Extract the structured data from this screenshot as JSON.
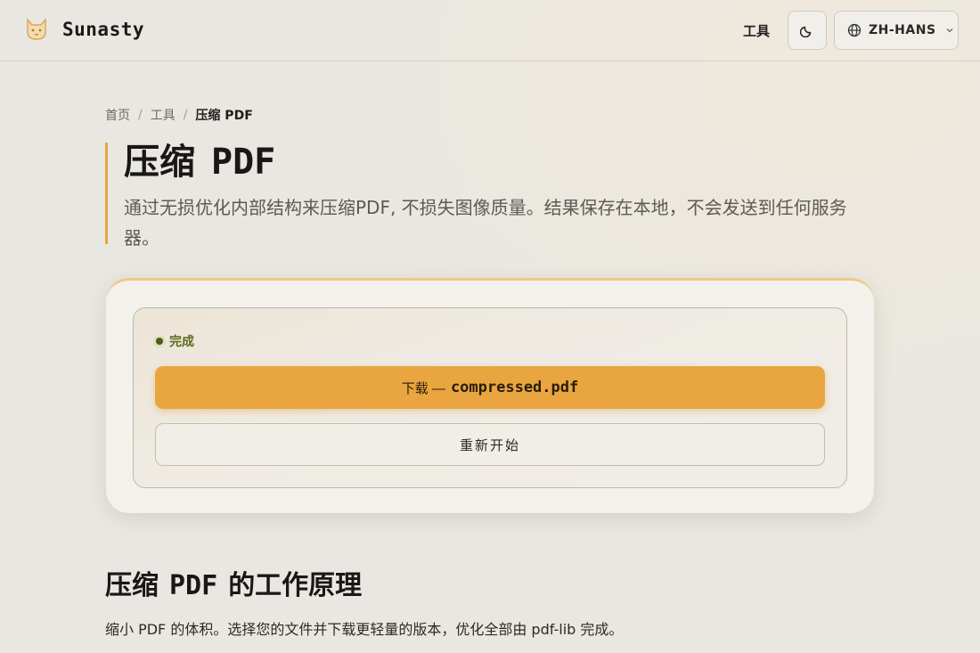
{
  "header": {
    "brand": "Sunasty",
    "nav_tools": "工具",
    "language": "ZH-HANS"
  },
  "breadcrumb": {
    "home": "首页",
    "tools": "工具",
    "current": "压缩 PDF"
  },
  "page": {
    "title_zh": "压缩",
    "title_pdf": "PDF",
    "description": "通过无损优化内部结构来压缩PDF, 不损失图像质量。结果保存在本地，不会发送到任何服务器。"
  },
  "result": {
    "status": "完成",
    "download_label": "下载 —",
    "download_filename": "compressed.pdf",
    "restart_label": "重新开始"
  },
  "how": {
    "title_pre": "压缩",
    "title_pdf": "PDF",
    "title_post": "的工作原理",
    "description": "缩小 PDF 的体积。选择您的文件并下载更轻量的版本，优化全部由 pdf-lib 完成。"
  },
  "colors": {
    "accent": "#e9a540",
    "status": "#4f5e12",
    "background": "#e9e7e1"
  }
}
